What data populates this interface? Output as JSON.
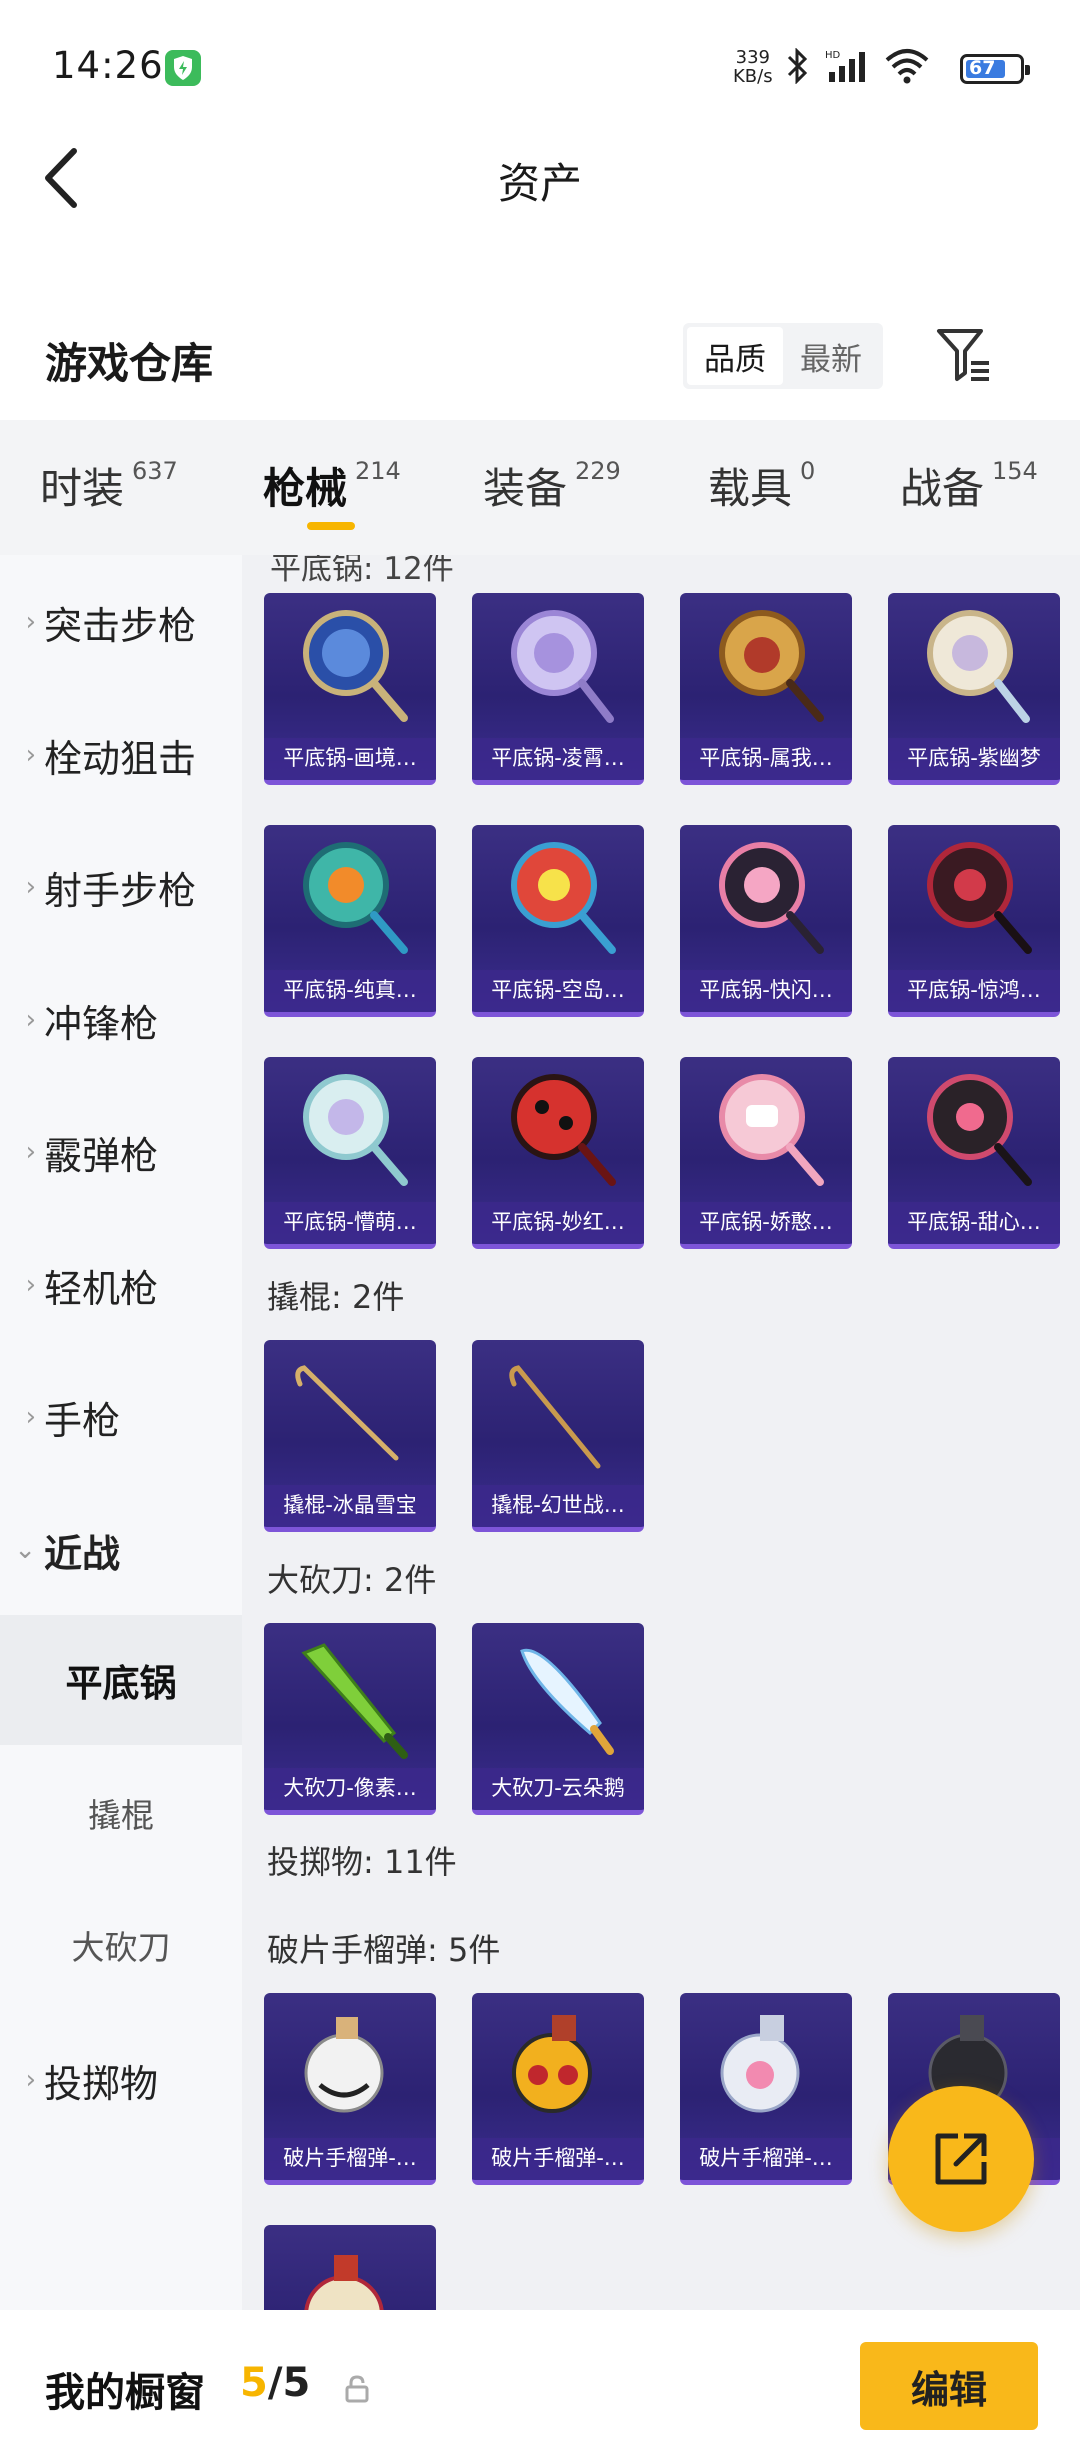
{
  "status": {
    "time": "14:26",
    "speed_value": "339",
    "speed_unit": "KB/s",
    "battery": "67",
    "signal_label": "HD"
  },
  "header": {
    "title": "资产",
    "back_icon": "chevron-left-icon"
  },
  "warehouse": {
    "title": "游戏仓库",
    "sort_options": [
      "品质",
      "最新"
    ],
    "sort_active": "品质",
    "filter_icon": "filter-icon"
  },
  "tabs": [
    {
      "label": "时装",
      "count": "637"
    },
    {
      "label": "枪械",
      "count": "214",
      "active": true
    },
    {
      "label": "装备",
      "count": "229"
    },
    {
      "label": "载具",
      "count": "0"
    },
    {
      "label": "战备",
      "count": "154"
    }
  ],
  "sidebar": {
    "items": [
      "突击步枪",
      "栓动狙击",
      "射手步枪",
      "冲锋枪",
      "霰弹枪",
      "轻机枪",
      "手枪",
      "近战"
    ],
    "expanded": "近战",
    "sub_items": [
      "平底锅",
      "撬棍",
      "大砍刀"
    ],
    "sub_active": "平底锅",
    "last_item": "投掷物"
  },
  "content": {
    "cut_header": "平底锅: 12件",
    "pan_items": [
      "平底锅-画境…",
      "平底锅-凌霄…",
      "平底锅-属我…",
      "平底锅-紫幽梦",
      "平底锅-纯真…",
      "平底锅-空岛…",
      "平底锅-快闪…",
      "平底锅-惊鸿…",
      "平底锅-懵萌…",
      "平底锅-妙红…",
      "平底锅-娇憨…",
      "平底锅-甜心…"
    ],
    "crowbar_header": "撬棍: 2件",
    "crowbar_items": [
      "撬棍-冰晶雪宝",
      "撬棍-幻世战…"
    ],
    "machete_header": "大砍刀: 2件",
    "machete_items": [
      "大砍刀-像素…",
      "大砍刀-云朵鹅"
    ],
    "throwables_header": "投掷物: 11件",
    "grenade_header": "破片手榴弹: 5件",
    "grenade_items": [
      "破片手榴弹-…",
      "破片手榴弹-…",
      "破片手榴弹-…",
      ""
    ]
  },
  "bottom": {
    "title": "我的橱窗",
    "count_current": "5",
    "count_total": "/5",
    "edit_label": "编辑"
  },
  "colors": {
    "accent": "#f9b81a",
    "card_bg": "#2c2273",
    "card_border": "#7d55d8"
  }
}
